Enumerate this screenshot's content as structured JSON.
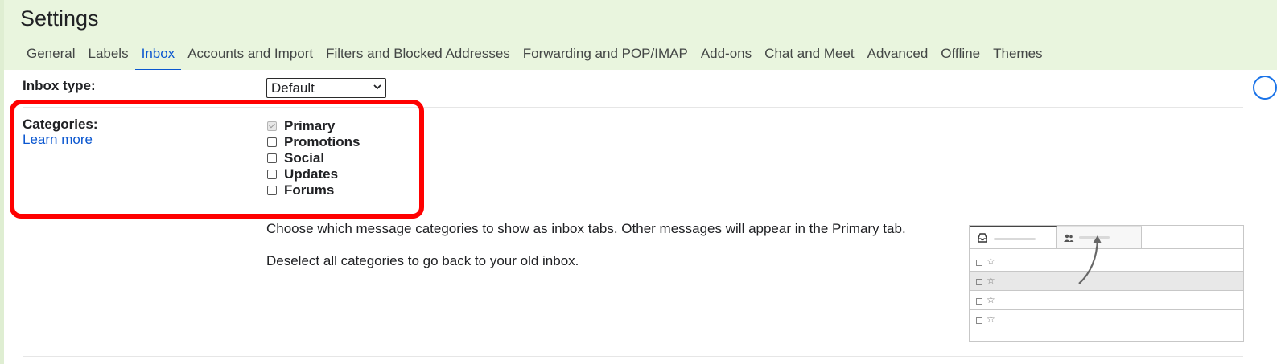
{
  "page": {
    "title": "Settings"
  },
  "tabs": [
    {
      "label": "General"
    },
    {
      "label": "Labels"
    },
    {
      "label": "Inbox",
      "active": true
    },
    {
      "label": "Accounts and Import"
    },
    {
      "label": "Filters and Blocked Addresses"
    },
    {
      "label": "Forwarding and POP/IMAP"
    },
    {
      "label": "Add-ons"
    },
    {
      "label": "Chat and Meet"
    },
    {
      "label": "Advanced"
    },
    {
      "label": "Offline"
    },
    {
      "label": "Themes"
    }
  ],
  "inbox_type": {
    "label": "Inbox type:",
    "selected": "Default"
  },
  "categories": {
    "label": "Categories:",
    "learn_more": "Learn more",
    "items": [
      {
        "label": "Primary",
        "checked": true,
        "disabled": true
      },
      {
        "label": "Promotions",
        "checked": false
      },
      {
        "label": "Social",
        "checked": false
      },
      {
        "label": "Updates",
        "checked": false
      },
      {
        "label": "Forums",
        "checked": false
      }
    ],
    "description": "Choose which message categories to show as inbox tabs. Other messages will appear in the Primary tab.",
    "note": "Deselect all categories to go back to your old inbox."
  },
  "illustration": {
    "row_star": "☆"
  },
  "colors": {
    "accent": "#0b57d0",
    "highlight": "#ff0000",
    "frame_bg": "#e9f5de"
  }
}
